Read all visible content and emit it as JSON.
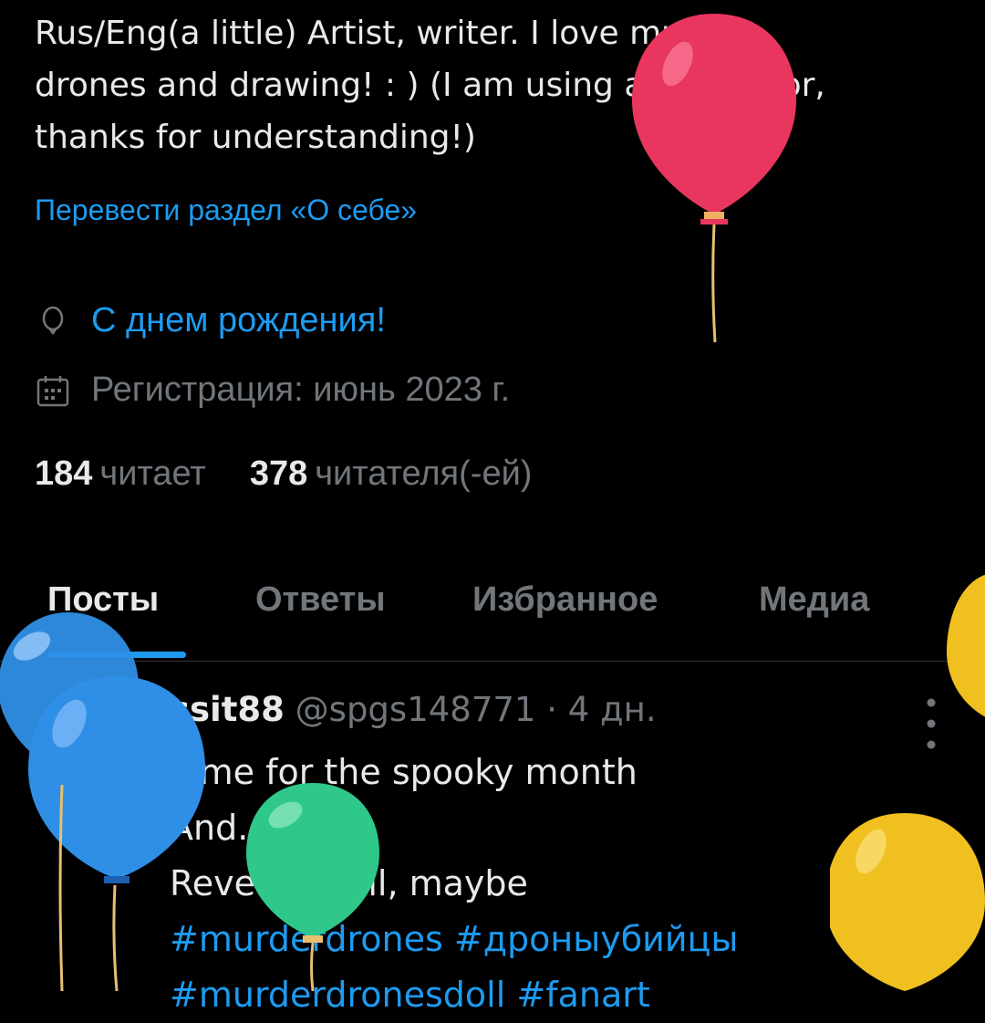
{
  "profile": {
    "bio_lines": [
      "Rus/Eng(a little) Artist, writer. I love murder",
      "drones and drawing! : ) (I am using a translator,",
      "thanks for understanding!)"
    ],
    "translate_bio": "Перевести раздел «О себе»",
    "birthday": "С днем рождения!",
    "joined": "Регистрация: июнь 2023 г.",
    "following_count": "184",
    "following_label": "читает",
    "followers_count": "378",
    "followers_label": "читателя(-ей)"
  },
  "tabs": [
    {
      "label": "Посты",
      "active": true
    },
    {
      "label": "Ответы",
      "active": false
    },
    {
      "label": "Избранное",
      "active": false
    },
    {
      "label": "Медиа",
      "active": false
    }
  ],
  "post": {
    "display_name": "ssit88",
    "handle": "@spgs148771",
    "separator": "·",
    "time": "4 дн.",
    "lines": [
      "Time for the spooky month",
      "And...",
      "Reverse Doll, maybe"
    ],
    "hashtags": [
      "#murderdrones",
      "#дроныубийцы",
      "#murderdronesdoll",
      "#fanart"
    ]
  },
  "icons": [
    "balloon-pin-icon",
    "calendar-icon",
    "more-icon"
  ],
  "colors": {
    "background": "#000000",
    "text": "#e7e9ea",
    "secondary": "#71767b",
    "accent": "#1d9bf0",
    "balloon_red": "#e8365e",
    "balloon_blue": "#2f8fe6",
    "balloon_green": "#2fc88a",
    "balloon_yellow": "#f0c020"
  }
}
